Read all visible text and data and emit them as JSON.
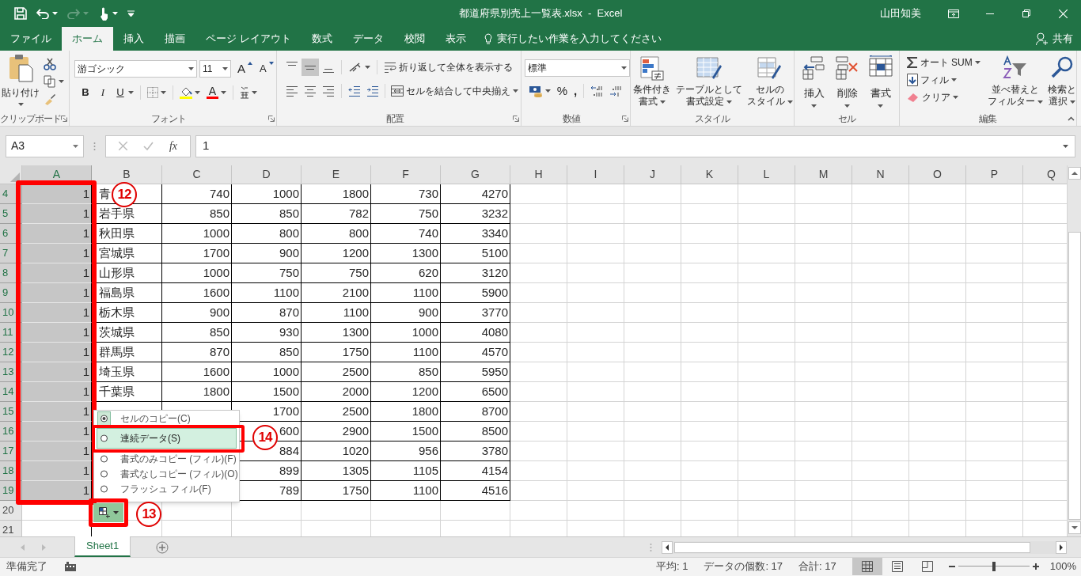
{
  "window": {
    "title": "都道府県別売上一覧表.xlsx  -  Excel",
    "user": "山田知美",
    "quick_access": [
      {
        "kind": "save",
        "disabled": false
      },
      {
        "kind": "undo",
        "disabled": false
      },
      {
        "kind": "redo",
        "disabled": true
      },
      {
        "kind": "touch",
        "disabled": false
      },
      {
        "kind": "customize",
        "disabled": false
      }
    ]
  },
  "tabs": [
    {
      "label": "ファイル",
      "selected": false
    },
    {
      "label": "ホーム",
      "selected": true
    },
    {
      "label": "挿入",
      "selected": false
    },
    {
      "label": "描画",
      "selected": false
    },
    {
      "label": "ページ レイアウト",
      "selected": false
    },
    {
      "label": "数式",
      "selected": false
    },
    {
      "label": "データ",
      "selected": false
    },
    {
      "label": "校閲",
      "selected": false
    },
    {
      "label": "表示",
      "selected": false
    }
  ],
  "tell_me": "実行したい作業を入力してください",
  "share": "共有",
  "ribbon": {
    "clipboard": {
      "label": "クリップボード",
      "paste": "貼り付け"
    },
    "font": {
      "label": "フォント",
      "name": "游ゴシック",
      "size": "11",
      "grow": "A",
      "shrink": "A",
      "bold": "B",
      "italic": "I",
      "underline": "U",
      "font_color": "A"
    },
    "alignment": {
      "label": "配置",
      "vertical": [
        {
          "kind": "top",
          "selected": false
        },
        {
          "kind": "middle",
          "selected": true
        },
        {
          "kind": "bottom",
          "selected": false
        }
      ],
      "horizontal": [
        {
          "kind": "left",
          "selected": false
        },
        {
          "kind": "center",
          "selected": false
        },
        {
          "kind": "right",
          "selected": false
        }
      ],
      "wrap": "折り返して全体を表示する",
      "merge": "セルを結合して中央揃え"
    },
    "number": {
      "label": "数値",
      "format": "標準",
      "percent": "%",
      "comma": ","
    },
    "styles": {
      "label": "スタイル",
      "buttons": [
        {
          "kind": "conditional",
          "lines": [
            "条件付き",
            "書式"
          ]
        },
        {
          "kind": "table",
          "lines": [
            "テーブルとして",
            "書式設定"
          ]
        },
        {
          "kind": "cell_styles",
          "lines": [
            "セルの",
            "スタイル"
          ]
        }
      ]
    },
    "cells": {
      "label": "セル",
      "buttons": [
        {
          "kind": "insert",
          "label": "挿入"
        },
        {
          "kind": "delete",
          "label": "削除"
        },
        {
          "kind": "format",
          "label": "書式"
        }
      ]
    },
    "editing": {
      "label": "編集",
      "autosum": "オート SUM",
      "fill": "フィル",
      "clear": "クリア",
      "sort": [
        "並べ替えと",
        "フィルター"
      ],
      "find": [
        "検索と",
        "選択"
      ]
    }
  },
  "formula_bar": {
    "name_box": "A3",
    "fx": "fx",
    "value": "1"
  },
  "columns": [
    {
      "label": "A",
      "selected": true
    },
    {
      "label": "B",
      "selected": false
    },
    {
      "label": "C",
      "selected": false
    },
    {
      "label": "D",
      "selected": false
    },
    {
      "label": "E",
      "selected": false
    },
    {
      "label": "F",
      "selected": false
    },
    {
      "label": "G",
      "selected": false
    },
    {
      "label": "H",
      "selected": false
    },
    {
      "label": "I",
      "selected": false
    },
    {
      "label": "J",
      "selected": false
    },
    {
      "label": "K",
      "selected": false
    },
    {
      "label": "L",
      "selected": false
    },
    {
      "label": "M",
      "selected": false
    },
    {
      "label": "N",
      "selected": false
    },
    {
      "label": "O",
      "selected": false
    },
    {
      "label": "P",
      "selected": false
    },
    {
      "label": "Q",
      "selected": false
    }
  ],
  "rows": [
    {
      "header": "4",
      "selected": true,
      "cells": [
        "1",
        "青",
        "740",
        "1000",
        "1800",
        "730",
        "4270"
      ]
    },
    {
      "header": "5",
      "selected": true,
      "cells": [
        "1",
        "岩手県",
        "850",
        "850",
        "782",
        "750",
        "3232"
      ]
    },
    {
      "header": "6",
      "selected": true,
      "cells": [
        "1",
        "秋田県",
        "1000",
        "800",
        "800",
        "740",
        "3340"
      ]
    },
    {
      "header": "7",
      "selected": true,
      "cells": [
        "1",
        "宮城県",
        "1700",
        "900",
        "1200",
        "1300",
        "5100"
      ]
    },
    {
      "header": "8",
      "selected": true,
      "cells": [
        "1",
        "山形県",
        "1000",
        "750",
        "750",
        "620",
        "3120"
      ]
    },
    {
      "header": "9",
      "selected": true,
      "cells": [
        "1",
        "福島県",
        "1600",
        "1100",
        "2100",
        "1100",
        "5900"
      ]
    },
    {
      "header": "10",
      "selected": true,
      "cells": [
        "1",
        "栃木県",
        "900",
        "870",
        "1100",
        "900",
        "3770"
      ]
    },
    {
      "header": "11",
      "selected": true,
      "cells": [
        "1",
        "茨城県",
        "850",
        "930",
        "1300",
        "1000",
        "4080"
      ]
    },
    {
      "header": "12",
      "selected": true,
      "cells": [
        "1",
        "群馬県",
        "870",
        "850",
        "1750",
        "1100",
        "4570"
      ]
    },
    {
      "header": "13",
      "selected": true,
      "cells": [
        "1",
        "埼玉県",
        "1600",
        "1000",
        "2500",
        "850",
        "5950"
      ]
    },
    {
      "header": "14",
      "selected": true,
      "cells": [
        "1",
        "千葉県",
        "1800",
        "1500",
        "2000",
        "1200",
        "6500"
      ]
    },
    {
      "header": "15",
      "selected": true,
      "cells": [
        "1",
        null,
        null,
        "1700",
        "2500",
        "1800",
        "8700"
      ]
    },
    {
      "header": "16",
      "selected": true,
      "cells": [
        "1",
        null,
        null,
        "600",
        "2900",
        "1500",
        "8500"
      ]
    },
    {
      "header": "17",
      "selected": true,
      "cells": [
        "1",
        null,
        null,
        "884",
        "1020",
        "956",
        "3780"
      ]
    },
    {
      "header": "18",
      "selected": true,
      "cells": [
        "1",
        null,
        null,
        "899",
        "1305",
        "1105",
        "4154"
      ]
    },
    {
      "header": "19",
      "selected": true,
      "cells": [
        "1",
        null,
        null,
        "789",
        "1750",
        "1100",
        "4516"
      ]
    },
    {
      "header": "20",
      "selected": false
    },
    {
      "header": "21",
      "selected": false
    }
  ],
  "fill_menu": {
    "items": [
      {
        "label": "セルのコピー(C)",
        "selected": true,
        "highlighted": false
      },
      {
        "label": "連続データ(S)",
        "selected": false,
        "highlighted": true
      },
      {
        "label": "書式のみコピー (フィル)(F)",
        "selected": false,
        "highlighted": false
      },
      {
        "label": "書式なしコピー (フィル)(O)",
        "selected": false,
        "highlighted": false
      },
      {
        "label": "フラッシュ フィル(F)",
        "selected": false,
        "highlighted": false
      }
    ]
  },
  "annotations": [
    {
      "label": "12"
    },
    {
      "label": "13"
    },
    {
      "label": "14"
    }
  ],
  "sheet_tabs": [
    {
      "label": "Sheet1",
      "selected": true
    }
  ],
  "status_bar": {
    "mode": "準備完了",
    "average": "平均: 1",
    "count": "データの個数: 17",
    "sum": "合計: 17",
    "views": [
      {
        "kind": "normal",
        "selected": true
      },
      {
        "kind": "page_layout",
        "selected": false
      },
      {
        "kind": "page_break",
        "selected": false
      }
    ],
    "zoom": {
      "level": 0.5,
      "label": "100%"
    }
  }
}
